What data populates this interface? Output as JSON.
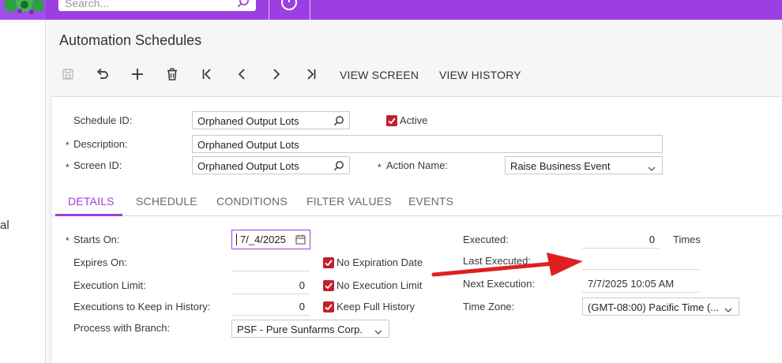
{
  "topbar": {
    "search_placeholder": "Search...",
    "accent_color": "#9b3fe3"
  },
  "leftnav": {
    "partial_label": "al"
  },
  "page": {
    "title": "Automation Schedules"
  },
  "toolbar": {
    "icons": [
      "save-icon",
      "undo-icon",
      "add-icon",
      "delete-icon",
      "first-icon",
      "previous-icon",
      "next-icon",
      "last-icon"
    ],
    "view_screen_label": "VIEW SCREEN",
    "view_history_label": "VIEW HISTORY"
  },
  "header_form": {
    "schedule_id_label": "Schedule ID:",
    "schedule_id_value": "Orphaned Output Lots",
    "active_label": "Active",
    "active_checked": true,
    "description_label": "Description:",
    "description_value": "Orphaned Output Lots",
    "screen_id_label": "Screen ID:",
    "screen_id_value": "Orphaned Output Lots",
    "action_name_label": "Action Name:",
    "action_name_value": "Raise Business Event",
    "required_marker": "*"
  },
  "tabs": [
    {
      "label": "DETAILS",
      "active": true
    },
    {
      "label": "SCHEDULE",
      "active": false
    },
    {
      "label": "CONDITIONS",
      "active": false
    },
    {
      "label": "FILTER VALUES",
      "active": false
    },
    {
      "label": "EVENTS",
      "active": false
    }
  ],
  "details": {
    "starts_on_label": "Starts On:",
    "starts_on_value": "7/_4/2025",
    "expires_on_label": "Expires On:",
    "no_expiration_label": "No Expiration Date",
    "execution_limit_label": "Execution Limit:",
    "execution_limit_value": "0",
    "no_execution_limit_label": "No Execution Limit",
    "executions_keep_label": "Executions to Keep in History:",
    "executions_keep_value": "0",
    "keep_full_history_label": "Keep Full History",
    "process_branch_label": "Process with Branch:",
    "process_branch_value": "PSF - Pure Sunfarms Corp.",
    "executed_label": "Executed:",
    "executed_value": "0",
    "executed_unit": "Times",
    "last_executed_label": "Last Executed:",
    "next_execution_label": "Next Execution:",
    "next_execution_value": "7/7/2025 10:05 AM",
    "time_zone_label": "Time Zone:",
    "time_zone_value": "(GMT-08:00) Pacific Time (..."
  },
  "annotation": {
    "arrow_color": "#e0201f"
  }
}
